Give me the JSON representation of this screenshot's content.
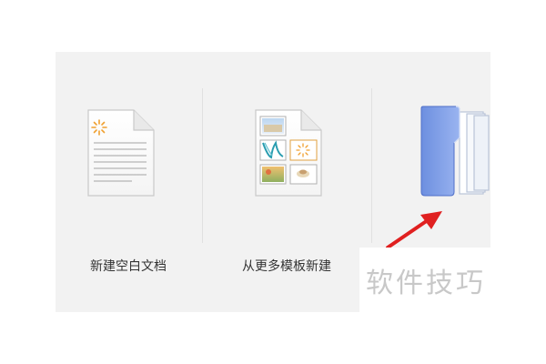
{
  "tiles": [
    {
      "label": "新建空白文档",
      "icon": "blank-document-icon"
    },
    {
      "label": "从更多模板新建",
      "icon": "template-document-icon"
    },
    {
      "label": "",
      "icon": "folder-open-icon"
    }
  ],
  "watermark": {
    "text": "软件技巧"
  },
  "colors": {
    "panel_bg": "#f2f2f2",
    "folder_blue": "#7f9fe8",
    "arrow_red": "#e02020",
    "accent_orange": "#f0a030"
  }
}
